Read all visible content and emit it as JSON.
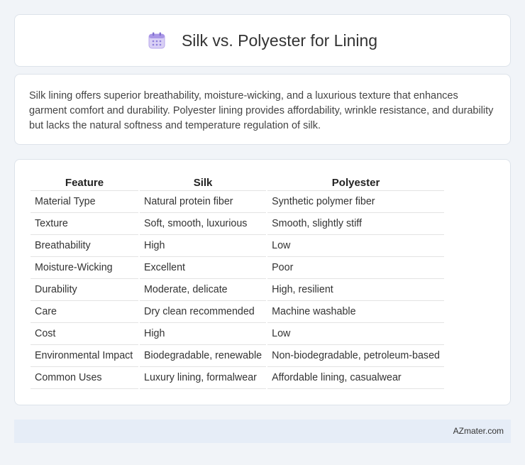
{
  "header": {
    "icon": "calendar-icon",
    "title": "Silk vs. Polyester for Lining"
  },
  "description": {
    "text": "Silk lining offers superior breathability, moisture-wicking, and a luxurious texture that enhances garment comfort and durability. Polyester lining provides affordability, wrinkle resistance, and durability but lacks the natural softness and temperature regulation of silk."
  },
  "table": {
    "headers": [
      "Feature",
      "Silk",
      "Polyester"
    ],
    "rows": [
      [
        "Material Type",
        "Natural protein fiber",
        "Synthetic polymer fiber"
      ],
      [
        "Texture",
        "Soft, smooth, luxurious",
        "Smooth, slightly stiff"
      ],
      [
        "Breathability",
        "High",
        "Low"
      ],
      [
        "Moisture-Wicking",
        "Excellent",
        "Poor"
      ],
      [
        "Durability",
        "Moderate, delicate",
        "High, resilient"
      ],
      [
        "Care",
        "Dry clean recommended",
        "Machine washable"
      ],
      [
        "Cost",
        "High",
        "Low"
      ],
      [
        "Environmental Impact",
        "Biodegradable, renewable",
        "Non-biodegradable, petroleum-based"
      ],
      [
        "Common Uses",
        "Luxury lining, formalwear",
        "Affordable lining, casualwear"
      ]
    ]
  },
  "footer": {
    "brand": "AZmater.com"
  }
}
